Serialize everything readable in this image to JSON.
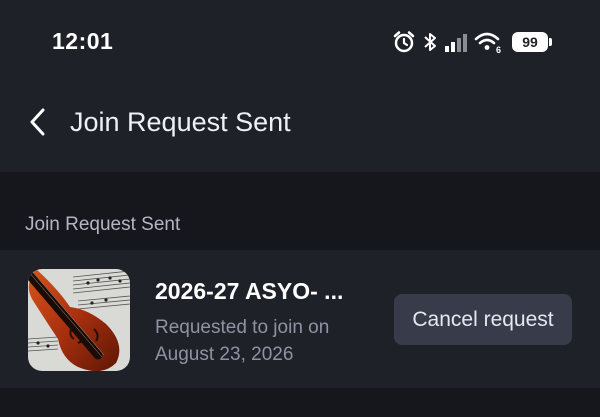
{
  "status_bar": {
    "time": "12:01",
    "icons": [
      "alarm-icon",
      "bluetooth-icon",
      "signal-icon",
      "wifi-icon"
    ],
    "wifi_badge": "6",
    "battery": "99"
  },
  "nav": {
    "title": "Join Request Sent",
    "back_icon": "chevron-left-icon"
  },
  "section": {
    "title": "Join Request Sent"
  },
  "request": {
    "group_name": "2026-27 ASYO- ...",
    "status_line1": "Requested to join on",
    "status_line2": "August 23, 2026",
    "cancel_label": "Cancel request",
    "thumbnail_icon": "violin-sheet-music-image"
  },
  "colors": {
    "background": "#16171c",
    "surface": "#1f2129",
    "button": "#383b49",
    "secondary_text": "#8e93a3"
  }
}
